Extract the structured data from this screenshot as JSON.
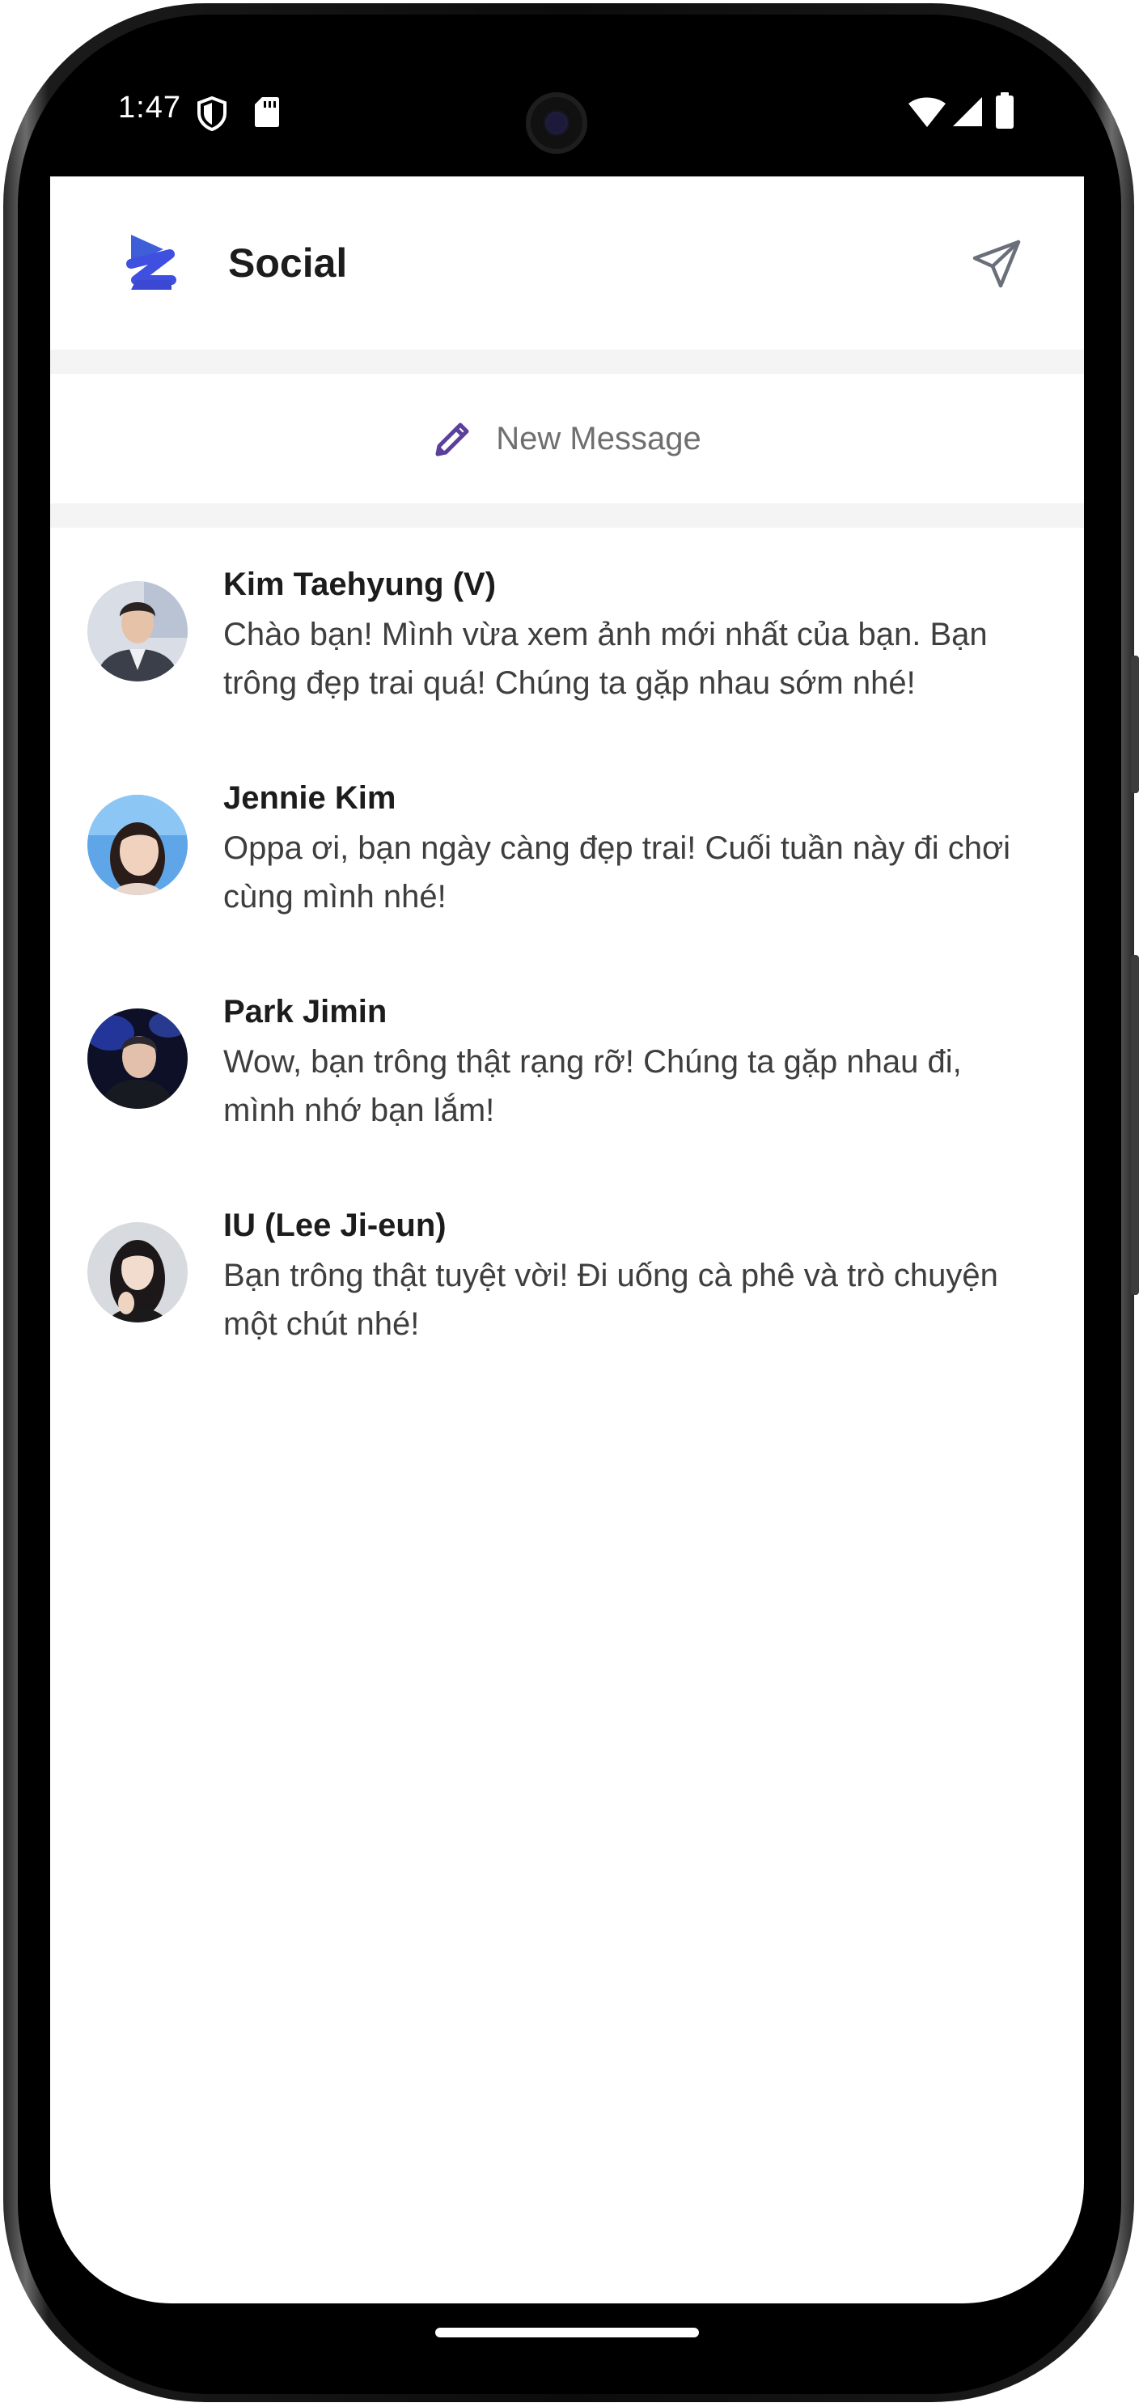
{
  "status": {
    "time": "1:47",
    "icons": [
      "shield-icon",
      "sd-card-icon",
      "wifi-icon",
      "signal-icon",
      "battery-icon"
    ]
  },
  "header": {
    "title": "Social",
    "logo_icon": "app-logo-icon",
    "send_icon": "send-icon",
    "accent": "#4a5bd6"
  },
  "new_message": {
    "label": "New Message",
    "icon": "pencil-icon",
    "icon_color": "#5b3f9c"
  },
  "conversations": [
    {
      "name": "Kim Taehyung (V)",
      "message": "Chào bạn! Mình vừa xem ảnh mới nhất của bạn. Bạn trông đẹp trai quá! Chúng ta gặp nhau sớm nhé!"
    },
    {
      "name": "Jennie Kim",
      "message": "Oppa ơi, bạn ngày càng đẹp trai! Cuối tuần này đi chơi cùng mình nhé!"
    },
    {
      "name": "Park Jimin",
      "message": "Wow, bạn trông thật rạng rỡ! Chúng ta gặp nhau đi, mình nhớ bạn lắm!"
    },
    {
      "name": "IU (Lee Ji-eun)",
      "message": "Bạn trông thật tuyệt vời! Đi uống cà phê và trò chuyện một chút nhé!"
    }
  ]
}
